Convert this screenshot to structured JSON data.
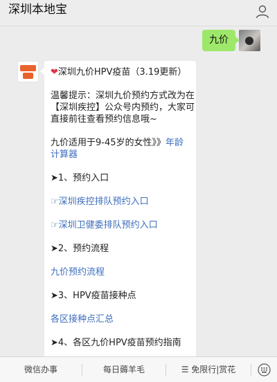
{
  "header": {
    "title": "深圳本地宝",
    "user_icon": "person-icon"
  },
  "chat": {
    "user_message": "九价",
    "bot_message": {
      "heart_icon": "heart-icon",
      "title": "深圳九价HPV疫苗（3.19更新）",
      "tip_lines": [
        "温馨提示：深圳九价预约方式改为在",
        "【深圳疾控】公众号内预约，大家可",
        "直接前往查看预约信息哦~"
      ],
      "age_line": "九价适用于9-45岁的女性》》",
      "age_link_1": "年龄",
      "age_link_2": "计算器",
      "section1": "➤1、预约入口",
      "link_cdc": "☞深圳疾控排队预约入口",
      "link_health": "☞深圳卫健委排队预约入口",
      "section2": "➤2、预约流程",
      "link_process": "九价预约流程",
      "section3": "➤3、HPV疫苗接种点",
      "link_sites": "各区接种点汇总",
      "section4": "➤4、各区九价HPV疫苗预约指南"
    }
  },
  "footer": {
    "menu": [
      "微信办事",
      "每日薅羊毛",
      "免限行|赏花"
    ],
    "menu_prefix_icon": "list-icon",
    "keyboard_icon": "emoji-keyboard-icon"
  }
}
